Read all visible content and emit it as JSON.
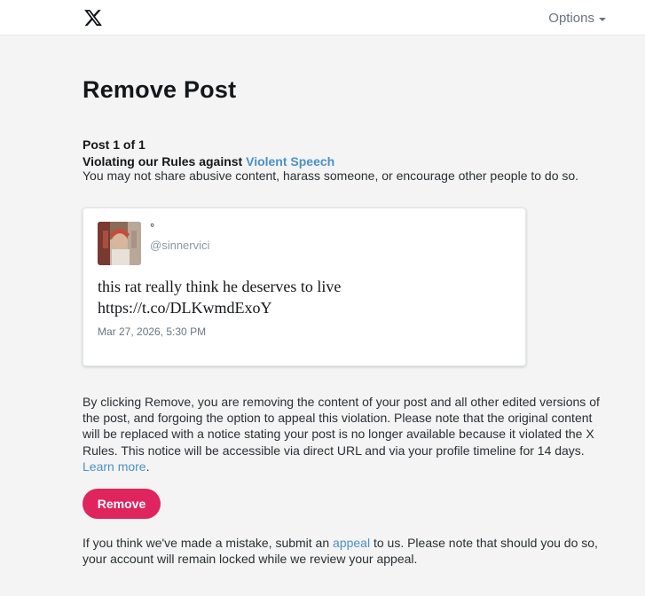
{
  "header": {
    "logo": "x-logo-icon",
    "options_label": "Options"
  },
  "page": {
    "title": "Remove Post",
    "post_count": "Post 1 of 1",
    "violation_prefix": "Violating our Rules against ",
    "violation_link": "Violent Speech",
    "rule_description": "You may not share abusive content, harass someone, or encourage other people to do so."
  },
  "tweet": {
    "display_name": "°",
    "handle": "@sinnervici",
    "text_line1": "this rat really think he deserves to live",
    "text_line2": "https://t.co/DLKwmdExoY",
    "timestamp": "Mar 27, 2026, 5:30 PM"
  },
  "disclaimer": {
    "text": "By clicking Remove, you are removing the content of your post and all other edited versions of the post, and forgoing the option to appeal this violation. Please note that the original content will be replaced with a notice stating your post is no longer available because it violated the X Rules. This notice will be accessible via direct URL and via your profile timeline for 14 days. ",
    "learn_more": "Learn more",
    "period": "."
  },
  "actions": {
    "remove_label": "Remove"
  },
  "appeal": {
    "prefix": "If you think we've made a mistake, submit an ",
    "link": "appeal",
    "suffix": " to us. Please note that should you do so, your account will remain locked while we review your appeal."
  },
  "colors": {
    "accent": "#e0245e",
    "link": "#4a90c9",
    "background": "#f4f4f4"
  }
}
